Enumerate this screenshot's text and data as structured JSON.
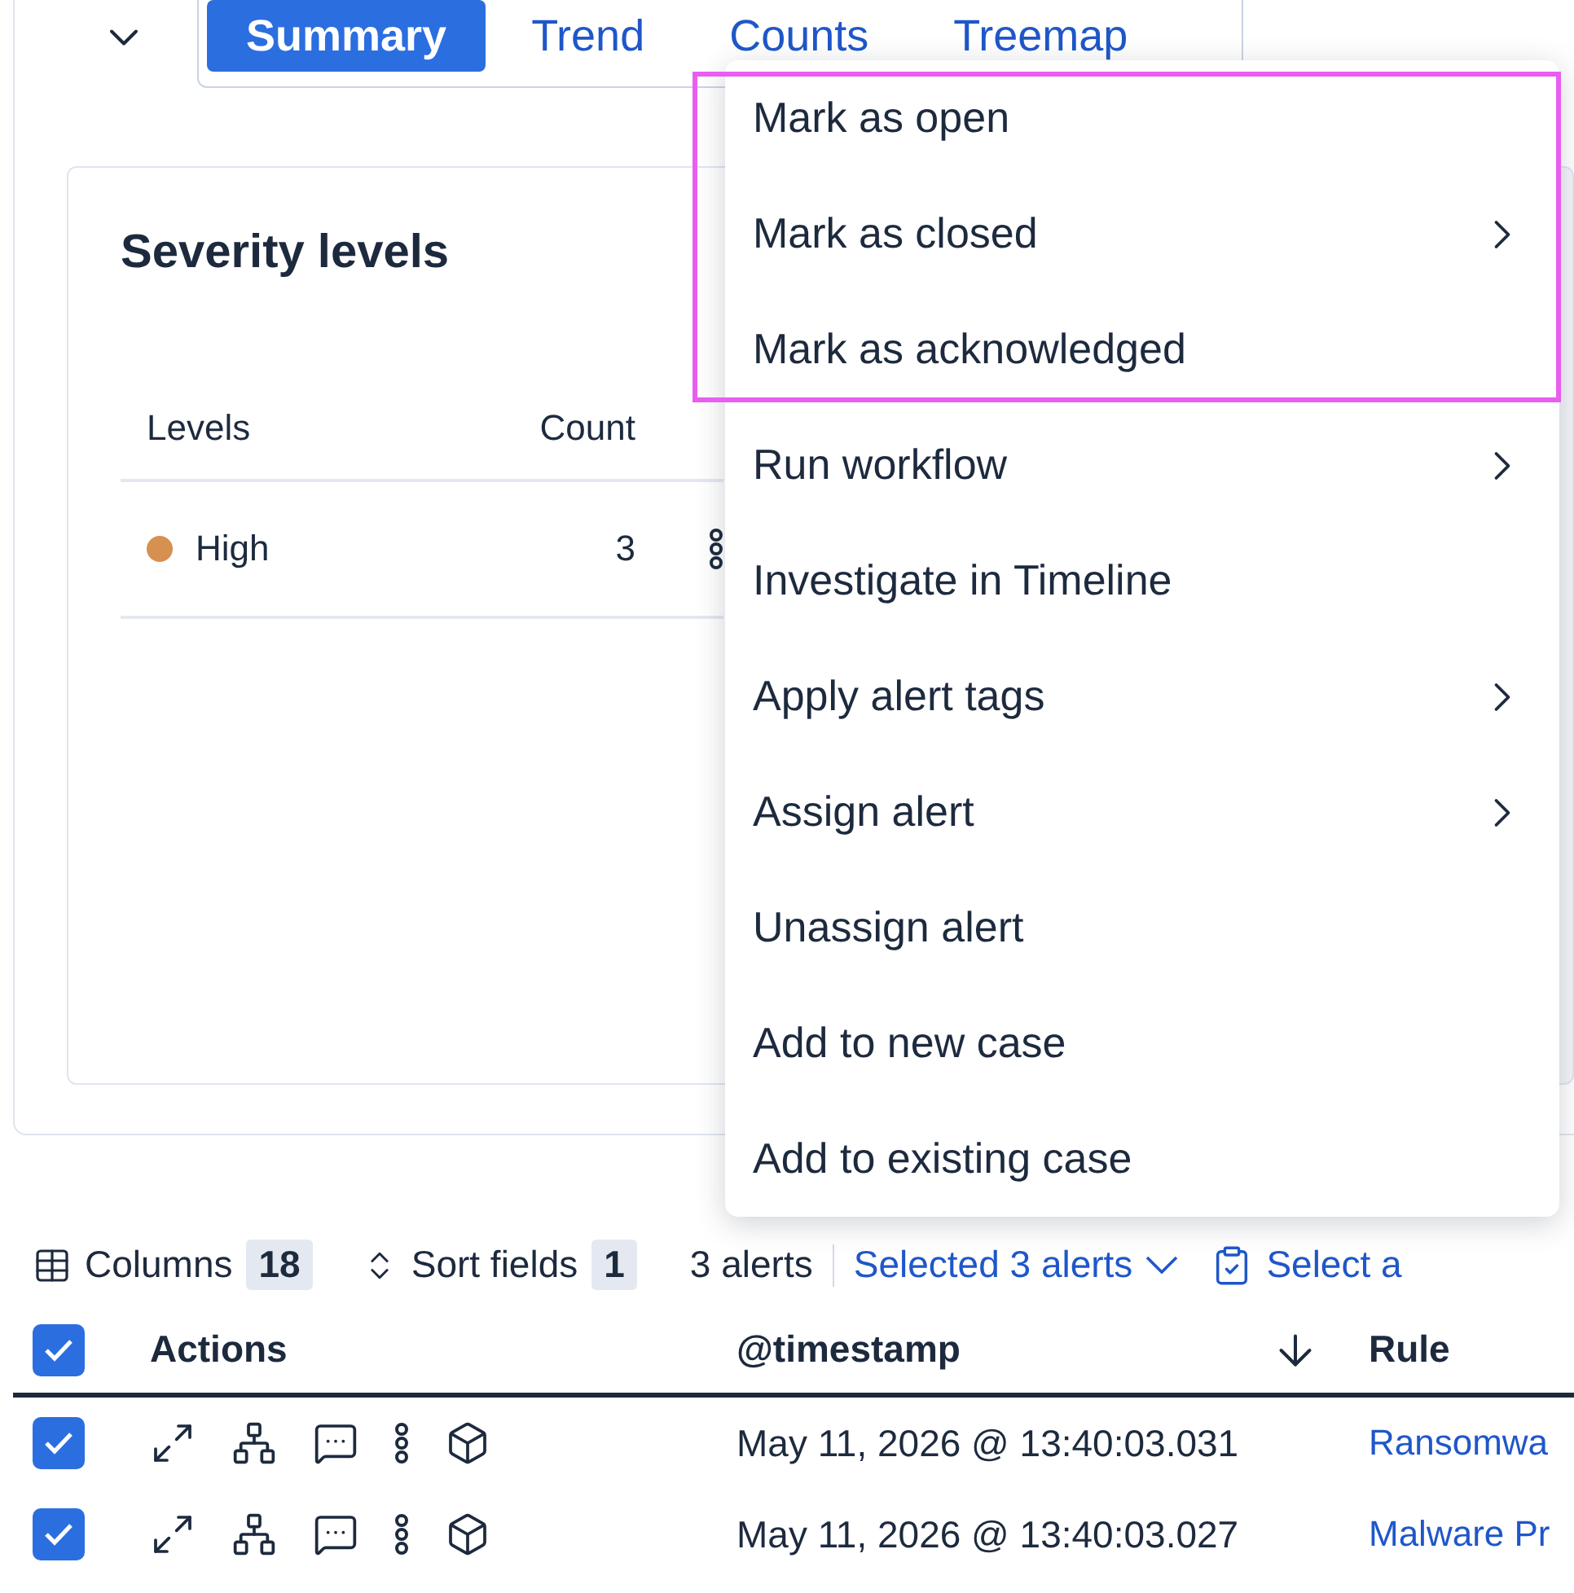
{
  "tabs": [
    {
      "label": "Summary",
      "selected": true
    },
    {
      "label": "Trend",
      "selected": false
    },
    {
      "label": "Counts",
      "selected": false
    },
    {
      "label": "Treemap",
      "selected": false
    }
  ],
  "severity_card": {
    "title": "Severity levels",
    "columns": [
      "Levels",
      "Count"
    ],
    "rows": [
      {
        "level": "High",
        "count": "3",
        "color": "#d6904f"
      }
    ]
  },
  "context_menu": {
    "items": [
      {
        "label": "Mark as open",
        "submenu": false,
        "highlighted": true
      },
      {
        "label": "Mark as closed",
        "submenu": true,
        "highlighted": true
      },
      {
        "label": "Mark as acknowledged",
        "submenu": false,
        "highlighted": true
      },
      {
        "label": "Run workflow",
        "submenu": true,
        "highlighted": false
      },
      {
        "label": "Investigate in Timeline",
        "submenu": false,
        "highlighted": false
      },
      {
        "label": "Apply alert tags",
        "submenu": true,
        "highlighted": false
      },
      {
        "label": "Assign alert",
        "submenu": true,
        "highlighted": false
      },
      {
        "label": "Unassign alert",
        "submenu": false,
        "highlighted": false
      },
      {
        "label": "Add to new case",
        "submenu": false,
        "highlighted": false
      },
      {
        "label": "Add to existing case",
        "submenu": false,
        "highlighted": false
      }
    ]
  },
  "toolbar": {
    "columns": {
      "label": "Columns",
      "count": "18"
    },
    "sort": {
      "label": "Sort fields",
      "count": "1"
    },
    "alert_count": "3 alerts",
    "selected": "Selected 3 alerts",
    "select_all": "Select a"
  },
  "table": {
    "all_checked": true,
    "columns": [
      "Actions",
      "@timestamp",
      "Rule"
    ],
    "rows": [
      {
        "checked": true,
        "timestamp": "May 11, 2026 @ 13:40:03.031",
        "rule": "Ransomwa"
      },
      {
        "checked": true,
        "timestamp": "May 11, 2026 @ 13:40:03.027",
        "rule": "Malware Pr"
      }
    ]
  }
}
